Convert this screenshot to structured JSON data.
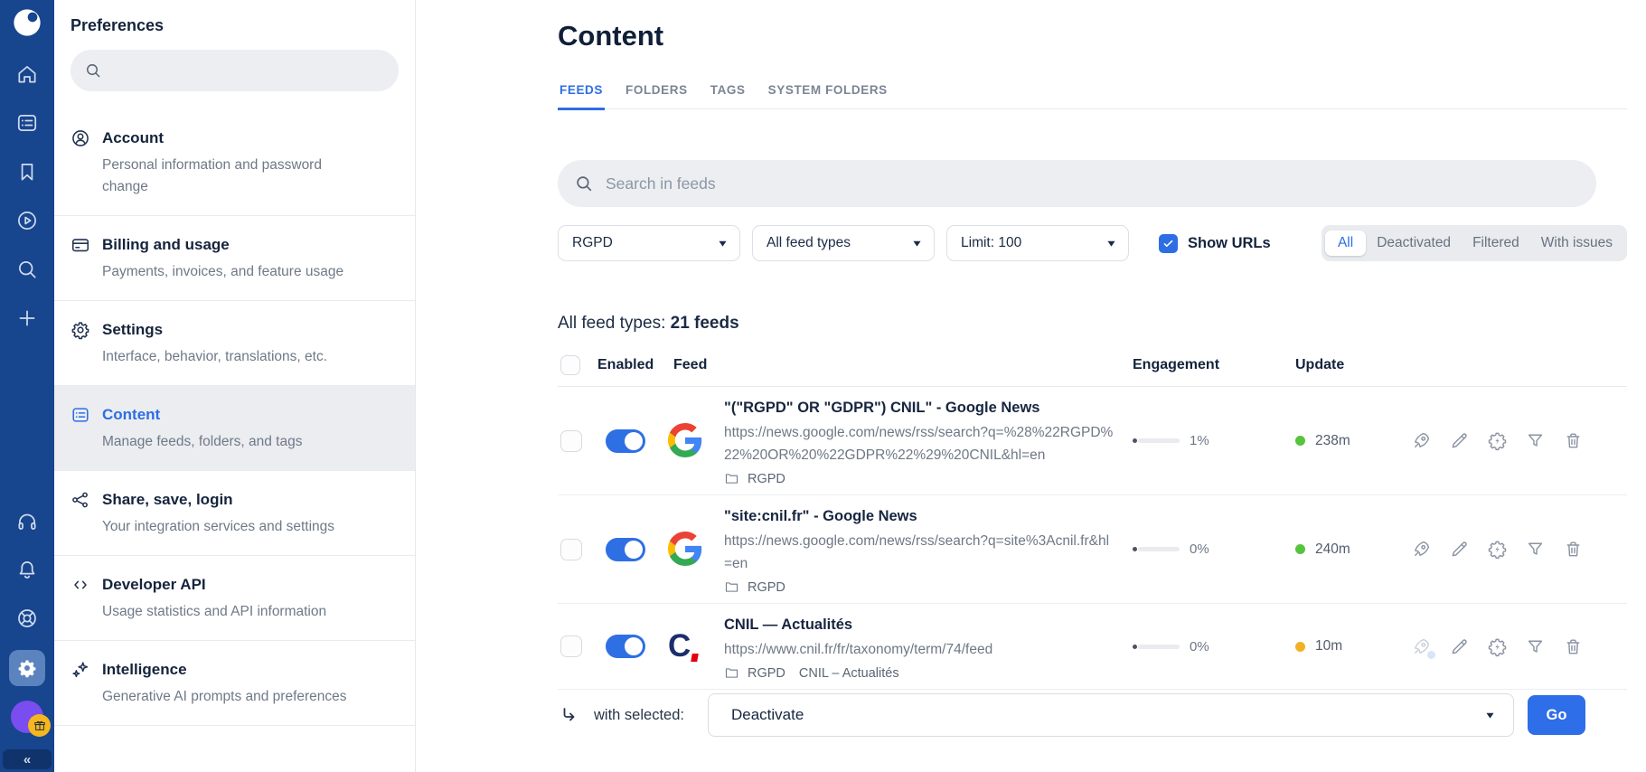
{
  "colors": {
    "accent": "#2e6ee5",
    "rail_blue": "#17458e",
    "green": "#56c43c",
    "amber": "#f2b124",
    "avatar_purple": "#7a4df0",
    "badge_yellow": "#f6b61e"
  },
  "rail": {
    "icons": [
      "app-logo",
      "home",
      "articles",
      "bookmark",
      "discover",
      "search",
      "add",
      "headphones",
      "notifications",
      "support",
      "settings-active",
      "profile-avatar",
      "gift",
      "collapse"
    ],
    "collapse_glyph": "«"
  },
  "sidebar": {
    "title": "Preferences",
    "search_placeholder": "",
    "items": [
      {
        "label": "Account",
        "desc": "Personal information and password change",
        "icon": "person-circle-icon",
        "active": false
      },
      {
        "label": "Billing and usage",
        "desc": "Payments, invoices, and feature usage",
        "icon": "credit-card-icon",
        "active": false
      },
      {
        "label": "Settings",
        "desc": "Interface, behavior, translations, etc.",
        "icon": "gear-icon",
        "active": false
      },
      {
        "label": "Content",
        "desc": "Manage feeds, folders, and tags",
        "icon": "list-box-icon",
        "active": true
      },
      {
        "label": "Share, save, login",
        "desc": "Your integration services and settings",
        "icon": "share-nodes-icon",
        "active": false
      },
      {
        "label": "Developer API",
        "desc": "Usage statistics and API information",
        "icon": "code-icon",
        "active": false
      },
      {
        "label": "Intelligence",
        "desc": "Generative AI prompts and preferences",
        "icon": "sparkles-icon",
        "active": false
      }
    ]
  },
  "main": {
    "title": "Content",
    "tabs": [
      {
        "label": "FEEDS",
        "active": true
      },
      {
        "label": "FOLDERS",
        "active": false
      },
      {
        "label": "TAGS",
        "active": false
      },
      {
        "label": "SYSTEM FOLDERS",
        "active": false
      }
    ],
    "search_placeholder": "Search in feeds",
    "filters": {
      "folder_select": "RGPD",
      "type_select": "All feed types",
      "limit_select": "Limit: 100",
      "show_urls_label": "Show URLs",
      "show_urls_checked": true,
      "segments": [
        "All",
        "Deactivated",
        "Filtered",
        "With issues"
      ],
      "active_segment": "All"
    },
    "summary": {
      "prefix": "All feed types:",
      "count": "21 feeds"
    },
    "table": {
      "headers": {
        "enabled": "Enabled",
        "feed": "Feed",
        "engagement": "Engagement",
        "update": "Update"
      },
      "rows": [
        {
          "title": "\"(\"RGPD\" OR \"GDPR\") CNIL\" - Google News",
          "url": "https://news.google.com/news/rss/search?q=%28%22RGPD%22%20OR%20%22GDPR%22%29%20CNIL&hl=en",
          "tags": [
            "RGPD"
          ],
          "enabled": true,
          "engagement": "1%",
          "update": "238m",
          "update_status": "green",
          "source_logo": "google-news",
          "boost_active": true
        },
        {
          "title": "\"site:cnil.fr\" - Google News",
          "url": "https://news.google.com/news/rss/search?q=site%3Acnil.fr&hl=en",
          "tags": [
            "RGPD"
          ],
          "enabled": true,
          "engagement": "0%",
          "update": "240m",
          "update_status": "green",
          "source_logo": "google-news",
          "boost_active": true
        },
        {
          "title": "CNIL — Actualités",
          "url": "https://www.cnil.fr/fr/taxonomy/term/74/feed",
          "tags": [
            "RGPD",
            "CNIL – Actualités"
          ],
          "enabled": true,
          "engagement": "0%",
          "update": "10m",
          "update_status": "amber",
          "source_logo": "cnil",
          "boost_active": false
        }
      ],
      "row_actions": [
        "boost",
        "edit",
        "automation",
        "filter",
        "delete"
      ]
    },
    "bulk": {
      "label": "with selected:",
      "action_selected": "Deactivate",
      "go_label": "Go"
    }
  }
}
